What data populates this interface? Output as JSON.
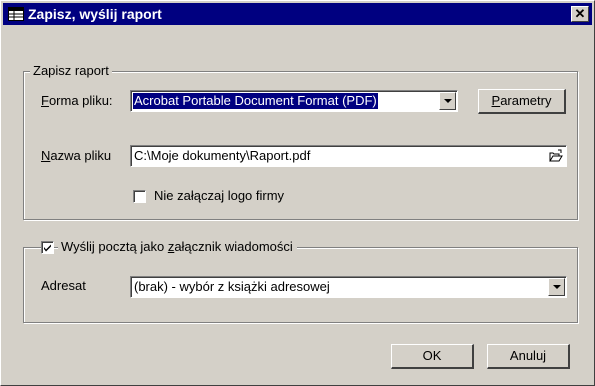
{
  "window": {
    "title": "Zapisz, wyślij raport",
    "close_glyph": "✕"
  },
  "save_group": {
    "legend": "Zapisz raport",
    "format_label_key": "F",
    "format_label_rest": "orma pliku:",
    "format_value": "Acrobat Portable Document Format (PDF)",
    "params_key": "P",
    "params_rest": "arametry",
    "filename_label_key": "N",
    "filename_label_rest": "azwa pliku",
    "filename_value": "C:\\Moje dokumenty\\Raport.pdf",
    "no_logo_label": "Nie załączaj logo firmy",
    "no_logo_checked": false
  },
  "mail_group": {
    "send_label_pre": "Wyślij pocztą jako ",
    "send_label_key": "z",
    "send_label_rest": "ałącznik wiadomości",
    "send_checked": true,
    "recipient_label": "Adresat",
    "recipient_value": "(brak) - wybór z książki adresowej"
  },
  "buttons": {
    "ok": "OK",
    "cancel": "Anuluj"
  },
  "icons": {
    "app": "report-icon",
    "browse": "open-folder-icon"
  }
}
